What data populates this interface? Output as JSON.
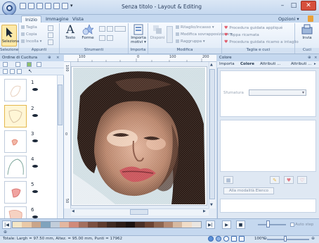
{
  "window": {
    "title": "Senza titolo - Layout & Editing",
    "minimize": "–",
    "maximize": "□",
    "close": "✕"
  },
  "tabs": [
    {
      "label": "Inizio",
      "active": true
    },
    {
      "label": "Immagine",
      "active": false
    },
    {
      "label": "Vista",
      "active": false
    }
  ],
  "options_label": "Opzioni ▾",
  "ribbon": {
    "selezione": {
      "button": "Seleziona",
      "group": "Selezione"
    },
    "appunti": {
      "taglia": "Taglia",
      "copia": "Copia",
      "incolla": "Incolla ▾",
      "group": "Appunti"
    },
    "strumenti": {
      "testo": "Testo",
      "forme": "Forme",
      "group": "Strumenti"
    },
    "importa": {
      "button": "Importa motivi ▾",
      "group": "Importa"
    },
    "modifica": {
      "disponi": "Disponi",
      "ritaglio": "Ritaglio/incasso ▾",
      "sovrapposizione": "Modifica sovrapposizione ▾",
      "raggruppa": "Raggruppa ▾",
      "group": "Modifica"
    },
    "taglia_cuci": {
      "applique": "Procedura guidata appliqué",
      "toppa": "Toppa ricamata",
      "intaglio": "Procedura guidata ricamo a intaglio",
      "group": "Taglia e cuci"
    },
    "cuci": {
      "invia": "Invia",
      "group": "Cuci"
    }
  },
  "left_panel": {
    "title": "Ordine di Cucitura",
    "items": [
      {
        "number": "1",
        "selected": false
      },
      {
        "number": "2",
        "selected": true
      },
      {
        "number": "3",
        "selected": false
      },
      {
        "number": "4",
        "selected": false
      },
      {
        "number": "5",
        "selected": false
      },
      {
        "number": "6",
        "selected": false
      }
    ]
  },
  "ruler": {
    "top": [
      "100",
      "0",
      "100",
      "200"
    ],
    "left": [
      "100",
      "0",
      "50"
    ]
  },
  "right_panel": {
    "title": "Colore",
    "tabs": [
      "Importa",
      "Colore",
      "Attributi ...",
      "Attributi ..."
    ],
    "sub_label": "Sfumatura",
    "alla_modalita": "Alla modalità Elenco"
  },
  "bottom": {
    "colors": [
      "#f4e6c6",
      "#e9c9a8",
      "#c9a58b",
      "#7fa3bd",
      "#c2cdda",
      "#e3b7a0",
      "#d08a7a",
      "#a36f5e",
      "#7a4f40",
      "#5d3b2e",
      "#3e2a22",
      "#2b1c17",
      "#1a1210",
      "#483027",
      "#6a4332",
      "#8d6550",
      "#b48a72",
      "#d6b9a1",
      "#f0dcc8",
      "#eae6e1"
    ],
    "speed_label": "Auto step"
  },
  "status": {
    "text": "Totale: Largh = 97.50 mm, Altez. = 95.00 mm, Punti = 17962",
    "zoom": "100%"
  }
}
